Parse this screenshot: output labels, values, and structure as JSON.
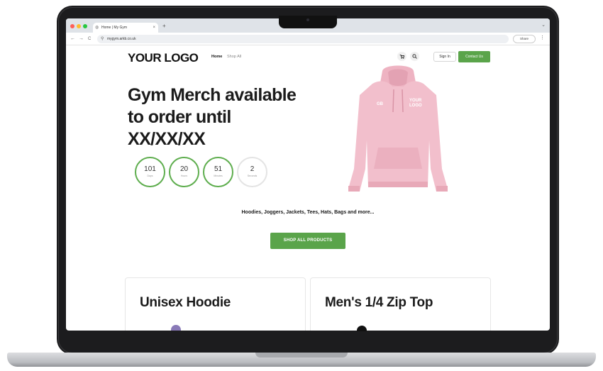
{
  "browser": {
    "tab_title": "Home | My Gym",
    "new_tab": "+",
    "url": "mygym.arkb.co.uk",
    "share_label": "Share",
    "menu": "⋮",
    "nav_back": "←",
    "nav_forward": "→",
    "nav_reload": "C",
    "tab_close": "×",
    "tabbar_menu": "⌄"
  },
  "site": {
    "logo": "YOUR LOGO",
    "nav": {
      "home": "Home",
      "shop_all": "Shop All"
    },
    "cart_icon": "cart-icon",
    "search_icon": "search-icon",
    "sign_in": "Sign In",
    "contact": "Contact Us"
  },
  "hero": {
    "title": "Gym Merch available to order until XX/XX/XX",
    "countdown": [
      {
        "value": "101",
        "label": "Days"
      },
      {
        "value": "20",
        "label": "Hours"
      },
      {
        "value": "51",
        "label": "Minutes"
      },
      {
        "value": "2",
        "label": "Seconds"
      }
    ],
    "hoodie_left_text": "GB",
    "hoodie_right_text": "YOUR LOGO"
  },
  "tagline": "Hoodies, Joggers, Jackets, Tees, Hats, Bags and more...",
  "shop_button": "SHOP ALL PRODUCTS",
  "products": [
    {
      "title": "Unisex Hoodie"
    },
    {
      "title": "Men's 1/4 Zip Top"
    }
  ],
  "colors": {
    "accent": "#5aa44a",
    "hoodie": "#f2bfcc",
    "laptop_bezel": "#1c1c1e"
  }
}
